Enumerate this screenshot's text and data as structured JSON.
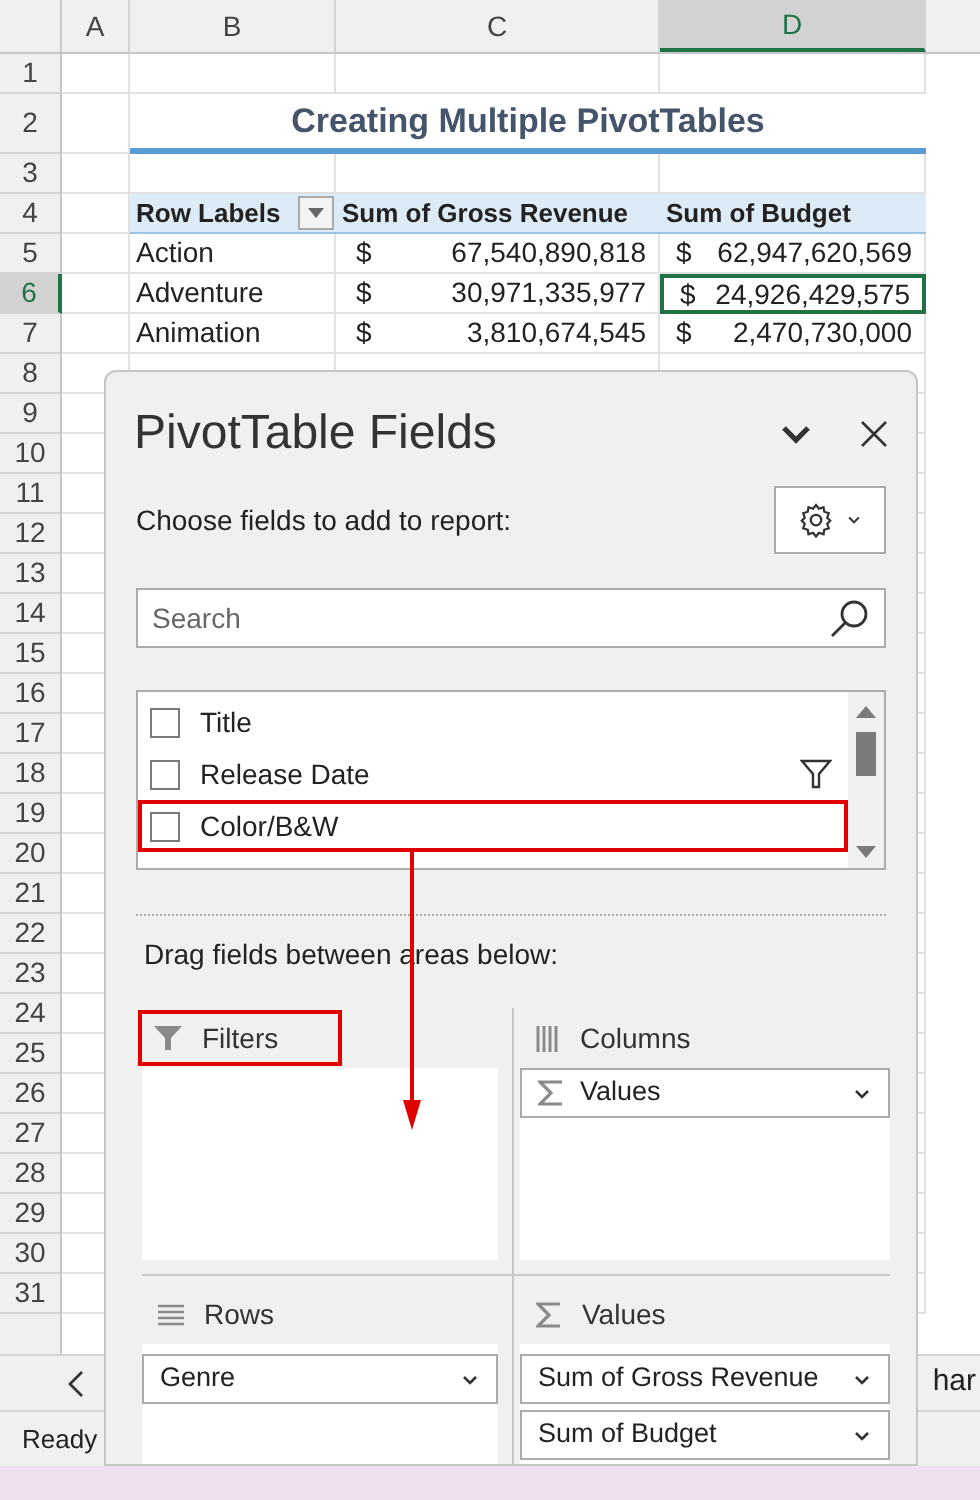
{
  "sheet": {
    "column_headers": [
      {
        "label": "A",
        "selected": false
      },
      {
        "label": "B",
        "selected": false
      },
      {
        "label": "C",
        "selected": false
      },
      {
        "label": "D",
        "selected": true
      }
    ],
    "row_headers": [
      {
        "label": "1",
        "selected": false
      },
      {
        "label": "2",
        "selected": false
      },
      {
        "label": "3",
        "selected": false
      },
      {
        "label": "4",
        "selected": false
      },
      {
        "label": "5",
        "selected": false
      },
      {
        "label": "6",
        "selected": true
      },
      {
        "label": "7",
        "selected": false
      },
      {
        "label": "8",
        "selected": false
      },
      {
        "label": "9",
        "selected": false
      },
      {
        "label": "10",
        "selected": false
      },
      {
        "label": "11",
        "selected": false
      },
      {
        "label": "12",
        "selected": false
      },
      {
        "label": "13",
        "selected": false
      },
      {
        "label": "14",
        "selected": false
      },
      {
        "label": "15",
        "selected": false
      },
      {
        "label": "16",
        "selected": false
      },
      {
        "label": "17",
        "selected": false
      },
      {
        "label": "18",
        "selected": false
      },
      {
        "label": "19",
        "selected": false
      },
      {
        "label": "20",
        "selected": false
      },
      {
        "label": "21",
        "selected": false
      },
      {
        "label": "22",
        "selected": false
      },
      {
        "label": "23",
        "selected": false
      },
      {
        "label": "24",
        "selected": false
      },
      {
        "label": "25",
        "selected": false
      },
      {
        "label": "26",
        "selected": false
      },
      {
        "label": "27",
        "selected": false
      },
      {
        "label": "28",
        "selected": false
      },
      {
        "label": "29",
        "selected": false
      },
      {
        "label": "30",
        "selected": false
      },
      {
        "label": "31",
        "selected": false
      }
    ],
    "title": "Creating Multiple PivotTables",
    "pivot": {
      "header": [
        "Row Labels",
        "Sum of Gross Revenue",
        "Sum of Budget"
      ],
      "rows": [
        {
          "label": "Action",
          "gross_currency": "$",
          "gross": "67,540,890,818",
          "budget_currency": "$",
          "budget": "62,947,620,569",
          "selected": false
        },
        {
          "label": "Adventure",
          "gross_currency": "$",
          "gross": "30,971,335,977",
          "budget_currency": "$",
          "budget": "24,926,429,575",
          "selected": true
        },
        {
          "label": "Animation",
          "gross_currency": "$",
          "gross": "3,810,674,545",
          "budget_currency": "$",
          "budget": "2,470,730,000",
          "selected": false
        }
      ]
    }
  },
  "sheet_tabs": {
    "tab": "har"
  },
  "status_bar": {
    "text": "Ready"
  },
  "pane": {
    "title": "PivotTable Fields",
    "choose_label": "Choose fields to add to report:",
    "search": {
      "placeholder": "Search"
    },
    "fields": [
      {
        "label": "Title",
        "checked": false,
        "filtered": false,
        "highlighted": false
      },
      {
        "label": "Release Date",
        "checked": false,
        "filtered": true,
        "highlighted": false
      },
      {
        "label": "Color/B&W",
        "checked": false,
        "filtered": false,
        "highlighted": true
      }
    ],
    "drag_label": "Drag fields between areas below:",
    "areas": [
      {
        "kind": "filters",
        "label": "Filters",
        "highlighted": true
      },
      {
        "kind": "columns",
        "label": "Columns",
        "highlighted": false,
        "items": [
          {
            "label": "Values",
            "kind": "values"
          }
        ]
      },
      {
        "kind": "rows",
        "label": "Rows",
        "highlighted": false,
        "items": [
          {
            "label": "Genre",
            "kind": "field"
          }
        ]
      },
      {
        "kind": "values",
        "label": "Values",
        "highlighted": false,
        "items": [
          {
            "label": "Sum of Gross Revenue",
            "kind": "field"
          },
          {
            "label": "Sum of Budget",
            "kind": "field"
          }
        ]
      }
    ]
  }
}
